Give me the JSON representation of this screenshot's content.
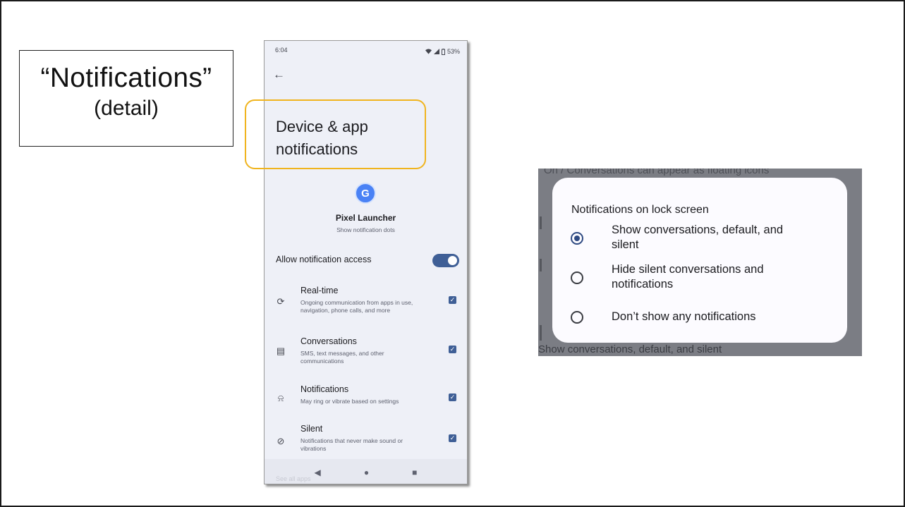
{
  "callout": {
    "title": "“Notifications”",
    "subtitle": "(detail)"
  },
  "phone": {
    "status": {
      "time": "6:04",
      "battery": "53%"
    },
    "page_title_line1": "Device & app",
    "page_title_line2": "notifications",
    "app": {
      "icon_letter": "G",
      "name": "Pixel Launcher",
      "subtitle": "Show notification dots"
    },
    "allow_access": {
      "label": "Allow notification access",
      "enabled": true
    },
    "rows": [
      {
        "icon": "sync-icon",
        "glyph": "⟳",
        "title": "Real-time",
        "desc": "Ongoing communication from apps in use, navigation, phone calls, and more",
        "checked": true
      },
      {
        "icon": "message-icon",
        "glyph": "▤",
        "title": "Conversations",
        "desc": "SMS, text messages, and other communications",
        "checked": true
      },
      {
        "icon": "bell-ring-icon",
        "glyph": "⍾",
        "title": "Notifications",
        "desc": "May ring or vibrate based on settings",
        "checked": true
      },
      {
        "icon": "bell-off-icon",
        "glyph": "⊘",
        "title": "Silent",
        "desc": "Notifications that never make sound or vibrations",
        "checked": true
      }
    ],
    "see_all": "See all apps",
    "nav": {
      "back_glyph": "◀",
      "home_glyph": "●",
      "recents_glyph": "■"
    },
    "colors": {
      "accent": "#3f5f96",
      "background": "#eef0f7",
      "highlight": "#f0b41e"
    }
  },
  "dialog": {
    "bg_top_text": "On / Conversations can appear as floating icons",
    "bg_bottom_text": "Show conversations, default, and silent",
    "title": "Notifications on lock screen",
    "options": [
      {
        "label_line1": "Show conversations, default, and",
        "label_line2": "silent",
        "selected": true
      },
      {
        "label_line1": "Hide silent conversations and",
        "label_line2": "notifications",
        "selected": false
      },
      {
        "label_line1": "Don’t show any notifications",
        "label_line2": "",
        "selected": false
      }
    ]
  }
}
